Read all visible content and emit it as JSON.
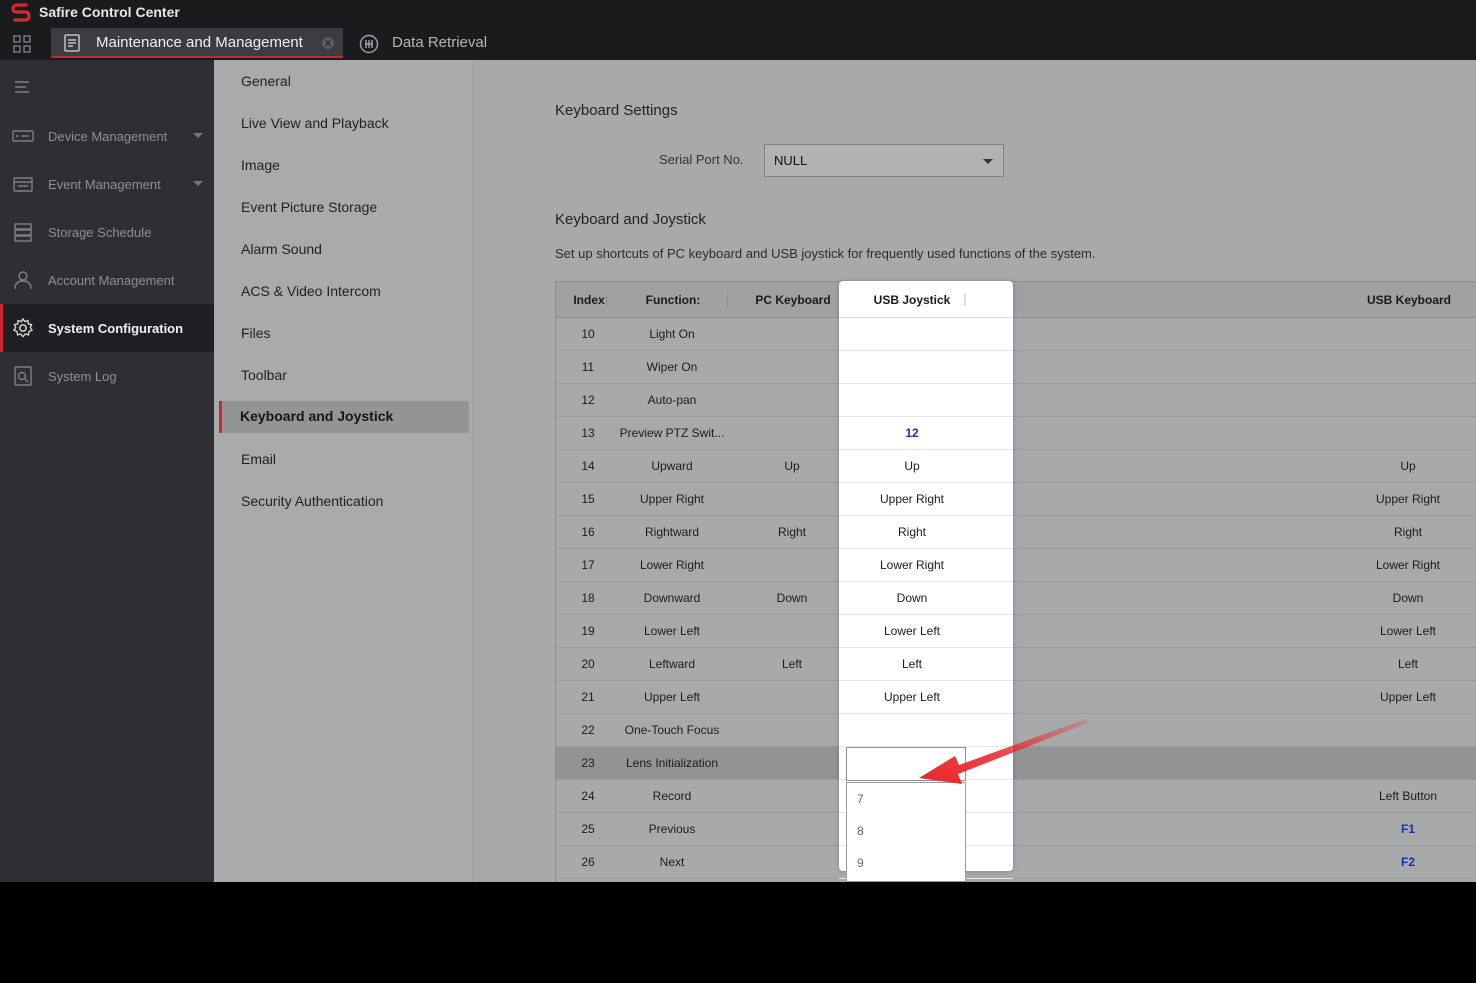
{
  "app": {
    "title": "Safire Control Center"
  },
  "tabs": [
    {
      "label": "Maintenance and Management",
      "active": true
    },
    {
      "label": "Data Retrieval",
      "active": false
    }
  ],
  "nav": [
    {
      "label": "Device Management",
      "icon": "device-icon",
      "has_caret": true
    },
    {
      "label": "Event Management",
      "icon": "event-icon",
      "has_caret": true
    },
    {
      "label": "Storage Schedule",
      "icon": "storage-icon",
      "has_caret": false
    },
    {
      "label": "Account Management",
      "icon": "user-icon",
      "has_caret": false
    },
    {
      "label": "System Configuration",
      "icon": "gear-icon",
      "has_caret": false,
      "active": true
    },
    {
      "label": "System Log",
      "icon": "log-icon",
      "has_caret": false
    }
  ],
  "submenu": [
    "General",
    "Live View and Playback",
    "Image",
    "Event Picture Storage",
    "Alarm Sound",
    "ACS & Video Intercom",
    "Files",
    "Toolbar",
    "Keyboard and Joystick",
    "Email",
    "Security Authentication"
  ],
  "submenu_active": "Keyboard and Joystick",
  "keyboard_settings": {
    "title": "Keyboard Settings",
    "serial_label": "Serial Port No.",
    "serial_value": "NULL"
  },
  "keyboard_joystick": {
    "title": "Keyboard and Joystick",
    "description": "Set up shortcuts of PC keyboard and USB joystick for frequently used functions of the system."
  },
  "table": {
    "headers": {
      "index": "Index",
      "function": "Function:",
      "pc": "PC Keyboard",
      "joystick": "USB Joystick",
      "usb": "USB Keyboard"
    },
    "rows": [
      {
        "index": "10",
        "function": "Light On",
        "pc": "",
        "joystick": "",
        "usb": ""
      },
      {
        "index": "11",
        "function": "Wiper On",
        "pc": "",
        "joystick": "",
        "usb": ""
      },
      {
        "index": "12",
        "function": "Auto-pan",
        "pc": "",
        "joystick": "",
        "usb": ""
      },
      {
        "index": "13",
        "function": "Preview PTZ Swit...",
        "pc": "",
        "joystick": "12",
        "joystick_blue": true,
        "usb": ""
      },
      {
        "index": "14",
        "function": "Upward",
        "pc": "Up",
        "joystick": "Up",
        "usb": "Up"
      },
      {
        "index": "15",
        "function": "Upper Right",
        "pc": "",
        "joystick": "Upper Right",
        "usb": "Upper Right"
      },
      {
        "index": "16",
        "function": "Rightward",
        "pc": "Right",
        "joystick": "Right",
        "usb": "Right"
      },
      {
        "index": "17",
        "function": "Lower Right",
        "pc": "",
        "joystick": "Lower Right",
        "usb": "Lower Right"
      },
      {
        "index": "18",
        "function": "Downward",
        "pc": "Down",
        "joystick": "Down",
        "usb": "Down"
      },
      {
        "index": "19",
        "function": "Lower Left",
        "pc": "",
        "joystick": "Lower Left",
        "usb": "Lower Left"
      },
      {
        "index": "20",
        "function": "Leftward",
        "pc": "Left",
        "joystick": "Left",
        "usb": "Left"
      },
      {
        "index": "21",
        "function": "Upper Left",
        "pc": "",
        "joystick": "Upper Left",
        "usb": "Upper Left"
      },
      {
        "index": "22",
        "function": "One-Touch Focus",
        "pc": "",
        "joystick": "",
        "usb": ""
      },
      {
        "index": "23",
        "function": "Lens Initialization",
        "pc": "",
        "joystick": "",
        "usb": "",
        "selected": true
      },
      {
        "index": "24",
        "function": "Record",
        "pc": "",
        "joystick": "",
        "usb": "Left Button"
      },
      {
        "index": "25",
        "function": "Previous",
        "pc": "",
        "joystick": "",
        "usb": "F1",
        "usb_blue": true
      },
      {
        "index": "26",
        "function": "Next",
        "pc": "",
        "joystick": "",
        "usb": "F2",
        "usb_blue": true
      }
    ]
  },
  "dropdown": {
    "value": "",
    "options": [
      "7",
      "8",
      "9"
    ]
  },
  "colors": {
    "accent": "#c8282d",
    "key_blue": "#1a2fb4",
    "arrow": "#e8262b"
  }
}
